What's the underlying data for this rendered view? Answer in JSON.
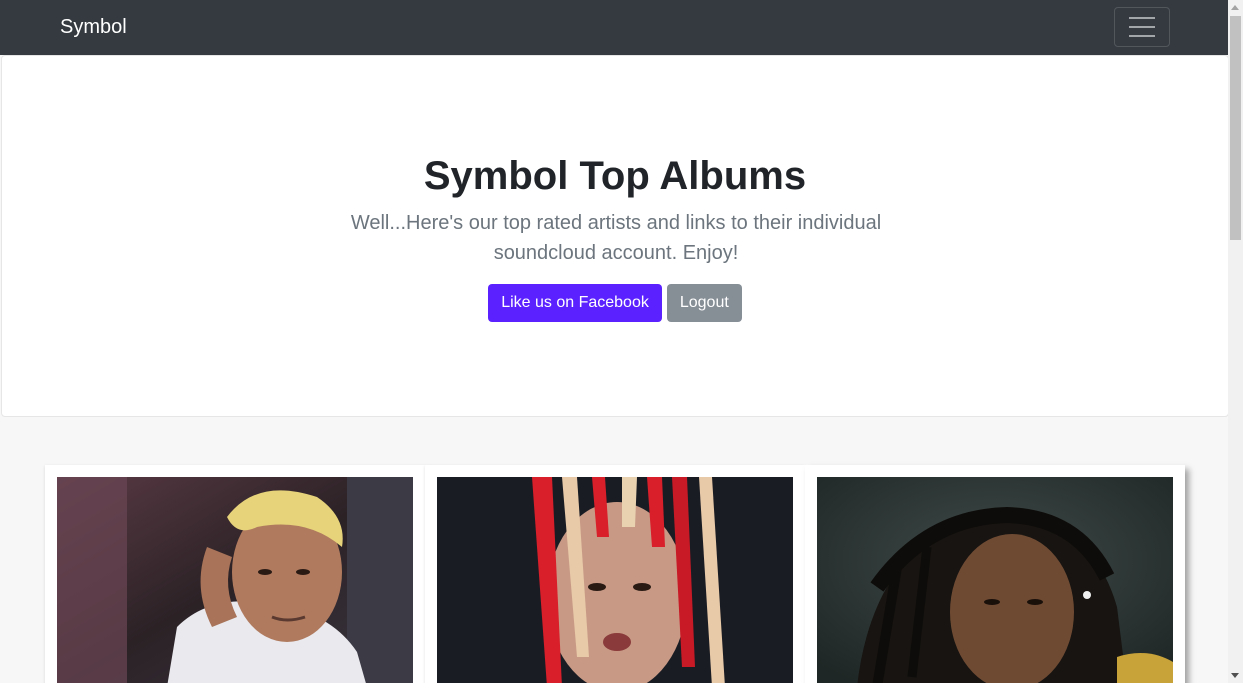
{
  "navbar": {
    "brand": "Symbol",
    "toggler_icon": "hamburger-menu-icon"
  },
  "jumbotron": {
    "title": "Symbol Top Albums",
    "lead": "Well...Here's our top rated artists and links to their individual soundcloud account. Enjoy!",
    "facebook_button": "Like us on Facebook",
    "logout_button": "Logout"
  },
  "colors": {
    "navbar_bg": "#343a40",
    "primary": "#5b22ff",
    "secondary": "#868e96",
    "page_bg": "#f7f7f7"
  },
  "cards": [
    {
      "image": "artist-photo-1"
    },
    {
      "image": "artist-photo-2"
    },
    {
      "image": "artist-photo-3"
    }
  ]
}
